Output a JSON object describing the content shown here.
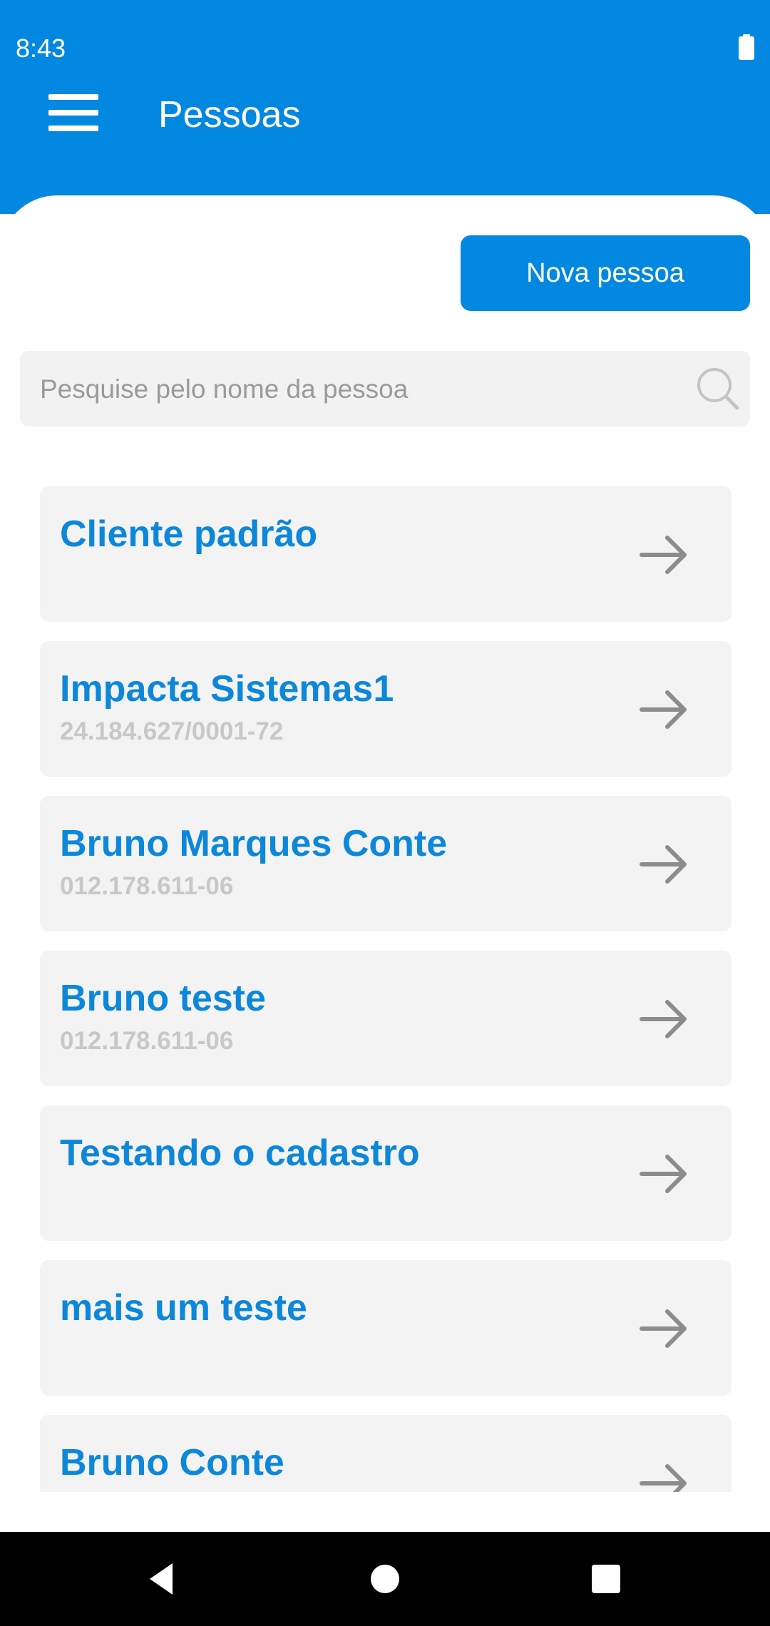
{
  "status_bar": {
    "time": "8:43"
  },
  "header": {
    "title": "Pessoas"
  },
  "actions": {
    "new_person_label": "Nova pessoa"
  },
  "search": {
    "placeholder": "Pesquise pelo nome da pessoa",
    "value": ""
  },
  "people": [
    {
      "name": "Cliente padrão",
      "document": ""
    },
    {
      "name": "Impacta Sistemas1",
      "document": "24.184.627/0001-72"
    },
    {
      "name": "Bruno Marques Conte",
      "document": "012.178.611-06"
    },
    {
      "name": "Bruno teste",
      "document": "012.178.611-06"
    },
    {
      "name": "Testando o cadastro",
      "document": ""
    },
    {
      "name": "mais um teste",
      "document": ""
    },
    {
      "name": "Bruno Conte",
      "document": ""
    }
  ],
  "icons": {
    "menu": "hamburger-menu-icon",
    "search": "search-icon",
    "arrow": "arrow-right-icon",
    "battery": "battery-icon",
    "nav_back": "back-icon",
    "nav_home": "home-icon",
    "nav_recents": "recents-icon"
  },
  "colors": {
    "primary": "#0288e0",
    "title_text": "#0d87d9",
    "card_bg": "#f3f3f3",
    "document_text": "#c8c8c8",
    "arrow": "#8c8c8c"
  }
}
